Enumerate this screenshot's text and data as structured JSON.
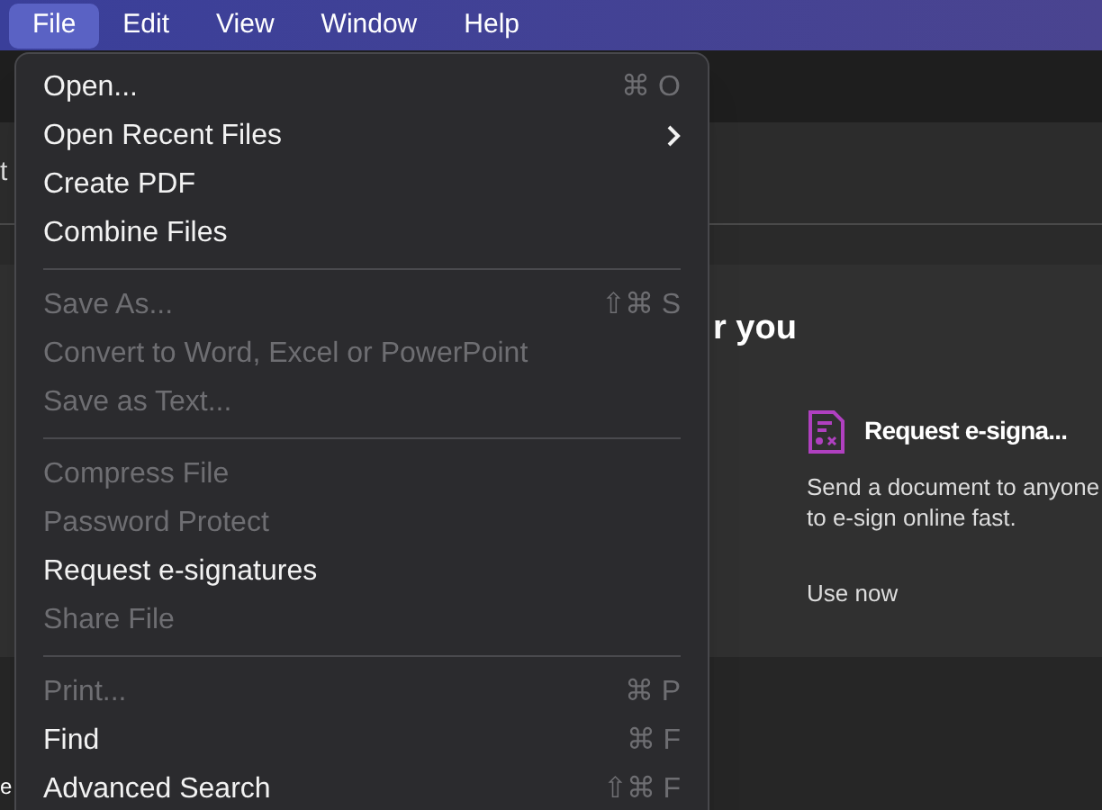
{
  "menu_bar": [
    {
      "label": "File",
      "selected": true
    },
    {
      "label": "Edit",
      "selected": false
    },
    {
      "label": "View",
      "selected": false
    },
    {
      "label": "Window",
      "selected": false
    },
    {
      "label": "Help",
      "selected": false
    }
  ],
  "background": {
    "fragments": [
      "t",
      "e"
    ],
    "section_heading": "r you",
    "card": {
      "title": "Request e-signa...",
      "description": "Send a document to anyone to e-sign online fast.",
      "action": "Use now"
    }
  },
  "file_menu": [
    {
      "kind": "item",
      "label": "Open...",
      "shortcut": "⌘ O",
      "disabled": false
    },
    {
      "kind": "submenu",
      "label": "Open Recent Files",
      "disabled": false
    },
    {
      "kind": "item",
      "label": "Create PDF",
      "disabled": false
    },
    {
      "kind": "item",
      "label": "Combine Files",
      "disabled": false
    },
    {
      "kind": "separator"
    },
    {
      "kind": "item",
      "label": "Save As...",
      "shortcut": "⇧⌘ S",
      "disabled": true
    },
    {
      "kind": "item",
      "label": "Convert to Word, Excel or PowerPoint",
      "disabled": true
    },
    {
      "kind": "item",
      "label": "Save as Text...",
      "disabled": true
    },
    {
      "kind": "separator"
    },
    {
      "kind": "item",
      "label": "Compress File",
      "disabled": true
    },
    {
      "kind": "item",
      "label": "Password Protect",
      "disabled": true
    },
    {
      "kind": "item",
      "label": "Request e-signatures",
      "disabled": false
    },
    {
      "kind": "item",
      "label": "Share File",
      "disabled": true
    },
    {
      "kind": "separator"
    },
    {
      "kind": "item",
      "label": "Print...",
      "shortcut": "⌘ P",
      "disabled": true
    },
    {
      "kind": "item",
      "label": "Find",
      "shortcut": "⌘ F",
      "disabled": false
    },
    {
      "kind": "item",
      "label": "Advanced Search",
      "shortcut": "⇧⌘ F",
      "disabled": false
    }
  ]
}
